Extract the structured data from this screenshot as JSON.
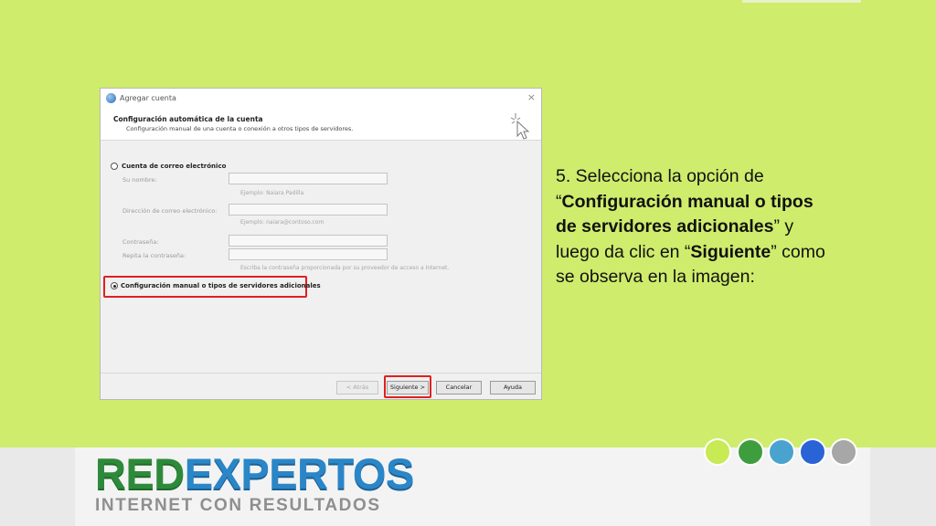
{
  "dialog": {
    "title": "Agregar cuenta",
    "close_symbol": "×",
    "header_title": "Configuración automática de la cuenta",
    "header_subtitle": "Configuración manual de una cuenta o conexión a otros tipos de servidores.",
    "wizard_icon": "cursor-sparkle-icon",
    "option_email": {
      "label": "Cuenta de correo electrónico",
      "checked": false
    },
    "fields": {
      "name_label": "Su nombre:",
      "name_hint": "Ejemplo: Naiara Padilla",
      "email_label": "Dirección de correo electrónico:",
      "email_hint": "Ejemplo: naiara@contoso.com",
      "password_label": "Contraseña:",
      "repeat_password_label": "Repita la contraseña:",
      "password_hint": "Escriba la contraseña proporcionada por su proveedor de acceso a Internet."
    },
    "option_manual": {
      "label": "Configuración manual o tipos de servidores adicionales",
      "checked": true
    },
    "buttons": {
      "back": "< Atrás",
      "next": "Siguiente >",
      "cancel": "Cancelar",
      "help": "Ayuda"
    }
  },
  "instructions": {
    "step_prefix": "5. Selecciona la opción de “",
    "option_name": "Configuración manual o tipos de servidores adicionales",
    "middle": "” y luego da clic en “",
    "button_name": "Siguiente",
    "suffix": "” como se observa en la imagen:"
  },
  "brand": {
    "logo_part1": "RED",
    "logo_part2": "EXPERTOS",
    "tagline": "INTERNET CON RESULTADOS",
    "dot_colors": [
      "#c7ea55",
      "#3e9e3e",
      "#4aa3cf",
      "#2a63d6",
      "#a7a7a7"
    ]
  },
  "colors": {
    "slide_background": "#cfec6c",
    "highlight": "#e02020"
  }
}
